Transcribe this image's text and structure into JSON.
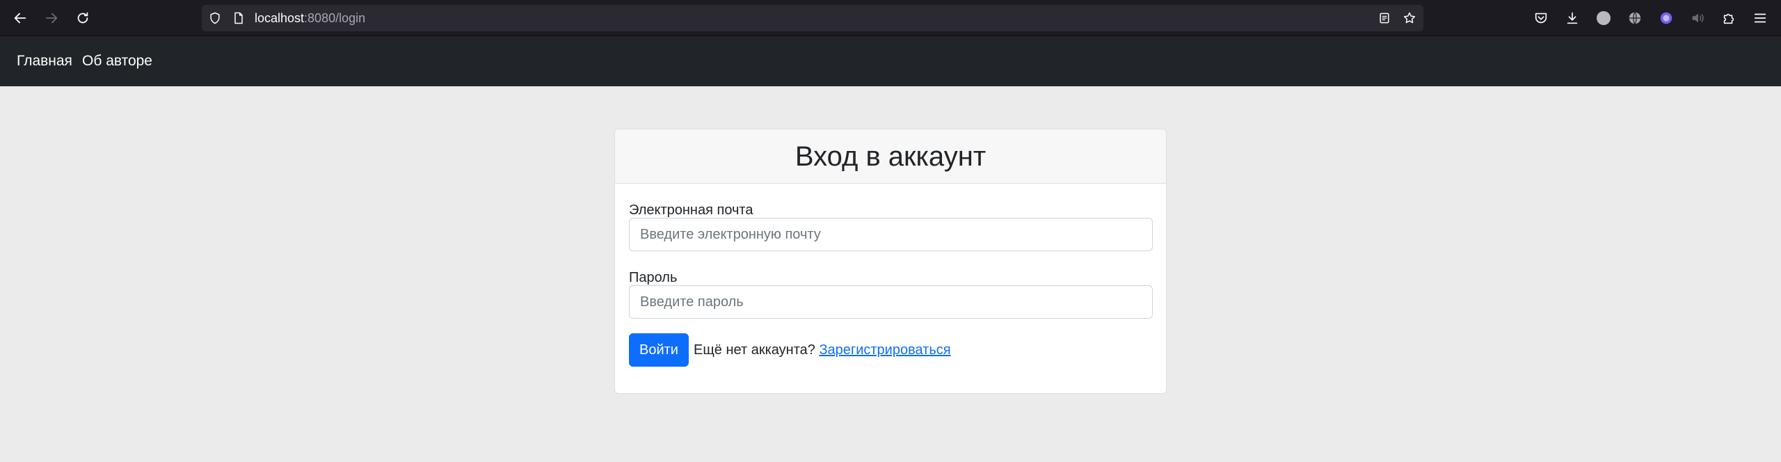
{
  "browser": {
    "url_host": "localhost",
    "url_rest": ":8080/login",
    "icons": {
      "back": "arrow-left-icon",
      "forward": "arrow-right-icon",
      "reload": "reload-icon",
      "shield": "shield-icon",
      "page": "page-icon",
      "reader": "reader-view-icon",
      "bookmark": "star-icon",
      "pocket": "pocket-icon",
      "downloads": "download-icon",
      "extensions": "puzzle-icon",
      "menu": "hamburger-menu-icon"
    }
  },
  "navbar": {
    "links": [
      {
        "label": "Главная"
      },
      {
        "label": "Об авторе"
      }
    ]
  },
  "login": {
    "title": "Вход в аккаунт",
    "email_label": "Электронная почта",
    "email_placeholder": "Введите электронную почту",
    "email_value": "",
    "password_label": "Пароль",
    "password_placeholder": "Введите пароль",
    "password_value": "",
    "submit_label": "Войти",
    "no_account_text": "Ещё нет аккаунта?",
    "register_link": "Зарегистрироваться"
  },
  "colors": {
    "primary": "#0d6efd",
    "navbar_bg": "#212529",
    "page_bg": "#ebebeb"
  }
}
